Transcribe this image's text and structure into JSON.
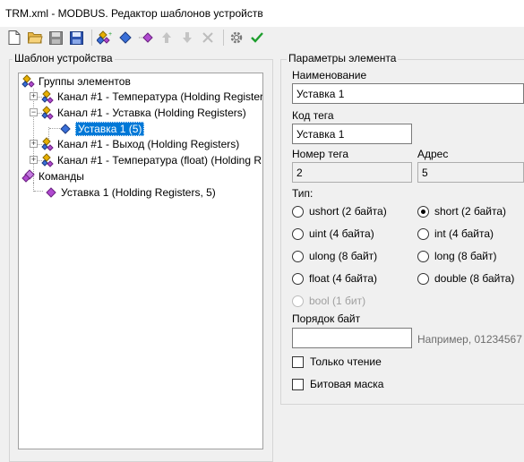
{
  "window": {
    "title": "TRM.xml - MODBUS. Редактор шаблонов устройств"
  },
  "toolbar": {
    "buttons": [
      "new-file-icon",
      "open-folder-icon",
      "save-icon",
      "save-as-icon",
      "add-group-icon",
      "add-element-icon",
      "add-command-icon",
      "move-up-icon",
      "move-down-icon",
      "delete-icon",
      "settings-icon",
      "apply-check-icon"
    ]
  },
  "template_panel": {
    "title": "Шаблон устройства",
    "tree": {
      "groups_root": "Группы элементов",
      "groups": [
        {
          "label": "Канал #1 - Температура (Holding Register",
          "expanded": false
        },
        {
          "label": "Канал #1 - Уставка (Holding Registers)",
          "expanded": true,
          "child": "Уставка 1 (5)"
        },
        {
          "label": "Канал #1 - Выход (Holding Registers)",
          "expanded": false
        },
        {
          "label": "Канал #1 - Температура (float) (Holding R",
          "expanded": false
        }
      ],
      "commands_root": "Команды",
      "commands": [
        {
          "label": "Уставка 1 (Holding Registers, 5)"
        }
      ]
    }
  },
  "params_panel": {
    "title": "Параметры элемента",
    "name_label": "Наименование",
    "name_value": "Уставка 1",
    "tag_code_label": "Код тега",
    "tag_code_value": "Уставка 1",
    "tag_number_label": "Номер тега",
    "tag_number_value": "2",
    "address_label": "Адрес",
    "address_value": "5",
    "type_label": "Тип:",
    "types": {
      "ushort": "ushort (2 байта)",
      "short": "short (2 байта)",
      "uint": "uint (4 байта)",
      "int": "int (4 байта)",
      "ulong": "ulong (8 байт)",
      "long": "long (8 байт)",
      "float": "float (4 байта)",
      "double": "double (8 байта)",
      "bool": "bool (1 бит)"
    },
    "selected_type": "short",
    "byte_order_label": "Порядок байт",
    "byte_order_value": "",
    "byte_order_hint": "Например, 01234567",
    "readonly_label": "Только чтение",
    "readonly_checked": false,
    "bitmask_label": "Битовая маска",
    "bitmask_checked": false
  },
  "colors": {
    "selection": "#0078d7",
    "apply": "#1e9e2e",
    "group_icon": "#e8b000",
    "element_icon": "#3a6fd8",
    "command_icon": "#b04ad0"
  }
}
